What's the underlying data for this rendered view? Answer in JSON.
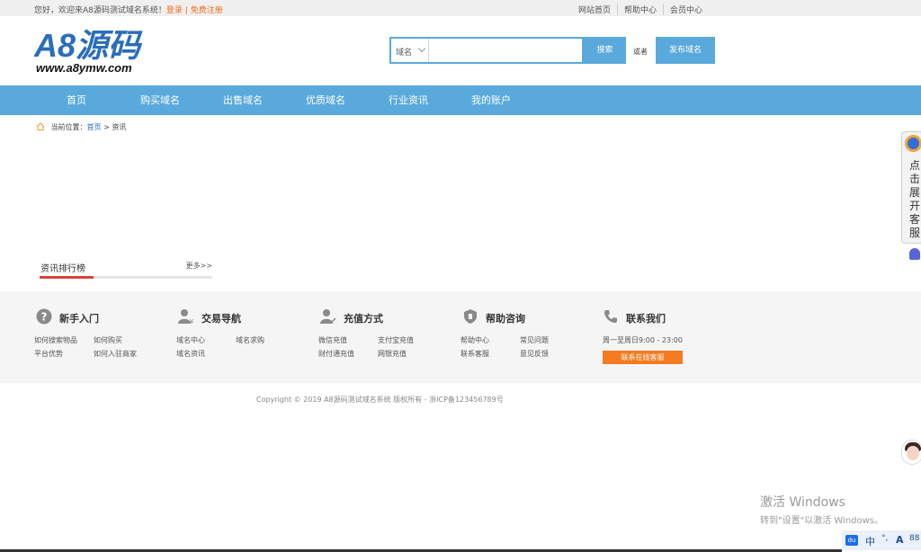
{
  "topbar": {
    "welcome": "您好，欢迎来A8源码测试域名系统！",
    "login": "登录",
    "sep": "|",
    "register": "免费注册",
    "links": [
      "网站首页",
      "帮助中心",
      "会员中心"
    ]
  },
  "logo": {
    "text": "A8源码",
    "url": "www.a8ymw.com"
  },
  "search": {
    "select_value": "域名",
    "input_value": "",
    "button": "搜索",
    "or": "或者",
    "publish": "发布域名"
  },
  "nav": [
    "首页",
    "购买域名",
    "出售域名",
    "优质域名",
    "行业资讯",
    "我的账户"
  ],
  "breadcrumb": {
    "label": "当前位置：",
    "home": "首页",
    "sep": ">",
    "current": "资讯"
  },
  "ranking": {
    "title": "资讯排行榜",
    "more": "更多>>"
  },
  "footer": {
    "columns": [
      {
        "title": "新手入门",
        "icon": "question-icon",
        "links": [
          "如何搜索物品",
          "如何购买",
          "平台优势",
          "如何入驻商家"
        ]
      },
      {
        "title": "交易导航",
        "icon": "user-money-icon",
        "links": [
          "域名中心",
          "域名求购",
          "域名资讯"
        ]
      },
      {
        "title": "充值方式",
        "icon": "user-recharge-icon",
        "links": [
          "微信充值",
          "支付宝充值",
          "财付通充值",
          "网银充值"
        ]
      },
      {
        "title": "帮助咨询",
        "icon": "shield-icon",
        "links": [
          "帮助中心",
          "常见问题",
          "联系客服",
          "意见反馈"
        ]
      },
      {
        "title": "联系我们",
        "icon": "phone-icon",
        "hours": "周一至周日9:00 - 23:00",
        "button": "联系在线客服"
      }
    ]
  },
  "copyright": "Copyright © 2019 A8源码测试域名系统 版权所有 - 浙ICP备123456789号",
  "side": {
    "panel_text": [
      "点",
      "击",
      "展",
      "开",
      "客",
      "服"
    ]
  },
  "watermark": {
    "line1": "激活 Windows",
    "line2": "转到\"设置\"以激活 Windows。"
  },
  "tray": {
    "ime": "中",
    "items": [
      "du",
      "中",
      "°,",
      "A",
      "88"
    ]
  },
  "colors": {
    "accent": "#5aa9dc",
    "orange": "#f47b20",
    "red": "#d9433b"
  }
}
